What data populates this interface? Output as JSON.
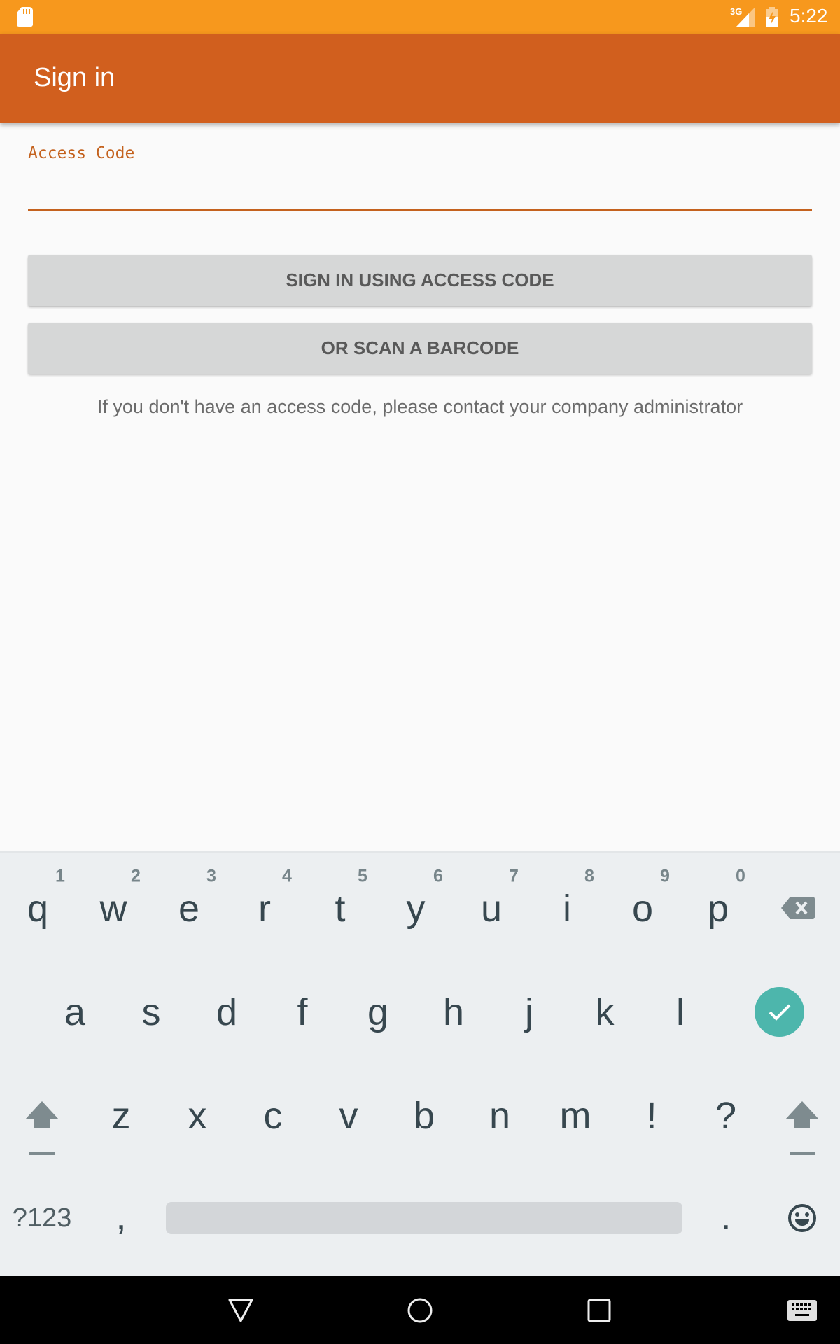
{
  "status_bar": {
    "time": "5:22",
    "network_label": "3G",
    "icons": [
      "sd-card-icon",
      "signal-icon",
      "battery-charging-icon"
    ],
    "color": "#F7981D"
  },
  "app_bar": {
    "title": "Sign in",
    "color": "#D15F1E"
  },
  "form": {
    "access_code_label": "Access Code",
    "access_code_value": "",
    "access_code_placeholder": "",
    "accent_color": "#C4621E"
  },
  "buttons": {
    "sign_in": "SIGN IN USING ACCESS CODE",
    "scan_barcode": "OR SCAN A BARCODE"
  },
  "helper_text": "If you don't have an access code, please contact your company administrator",
  "keyboard": {
    "row1": [
      {
        "key": "q",
        "hint": "1"
      },
      {
        "key": "w",
        "hint": "2"
      },
      {
        "key": "e",
        "hint": "3"
      },
      {
        "key": "r",
        "hint": "4"
      },
      {
        "key": "t",
        "hint": "5"
      },
      {
        "key": "y",
        "hint": "6"
      },
      {
        "key": "u",
        "hint": "7"
      },
      {
        "key": "i",
        "hint": "8"
      },
      {
        "key": "o",
        "hint": "9"
      },
      {
        "key": "p",
        "hint": "0"
      }
    ],
    "row2": [
      "a",
      "s",
      "d",
      "f",
      "g",
      "h",
      "j",
      "k",
      "l"
    ],
    "row3": [
      "z",
      "x",
      "c",
      "v",
      "b",
      "n",
      "m",
      "!",
      "?"
    ],
    "symbols_key": "?123",
    "comma_key": ",",
    "period_key": ".",
    "enter_color": "#4DB6AC"
  },
  "nav_bar": {
    "icons": [
      "back-icon",
      "home-icon",
      "recents-icon",
      "keyboard-switch-icon"
    ]
  }
}
